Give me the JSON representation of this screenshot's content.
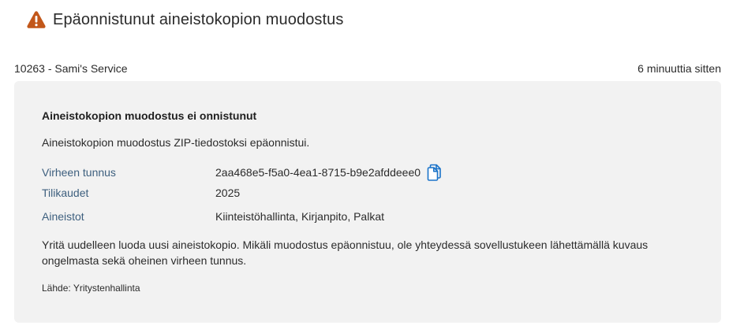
{
  "header": {
    "icon": "warning-icon",
    "icon_color": "#c2571a",
    "title": "Epäonnistunut aineistokopion muodostus"
  },
  "meta": {
    "source_label": "10263 - Sami's Service",
    "time_ago": "6 minuuttia sitten"
  },
  "card": {
    "title": "Aineistokopion muodostus ei onnistunut",
    "description": "Aineistokopion muodostus ZIP-tiedostoksi epäonnistui.",
    "details": [
      {
        "label": "Virheen tunnus",
        "value": "2aa468e5-f5a0-4ea1-8715-b9e2afddeee0",
        "action_icon": "copy-icon"
      },
      {
        "label": "Tilikaudet",
        "value": "2025"
      },
      {
        "label": "Aineistot",
        "value": "Kiinteistöhallinta, Kirjanpito, Palkat"
      }
    ],
    "note": "Yritä uudelleen luoda uusi aineistokopio. Mikäli muodostus epäonnistuu, ole yhteydessä sovellustukeen lähettämällä kuvaus ongelmasta sekä oheinen virheen tunnus.",
    "source": "Lähde: Yritystenhallinta"
  },
  "colors": {
    "accent": "#1a73c9",
    "label": "#3d5f7e",
    "card_bg": "#f2f2f2",
    "warning": "#c2571a"
  }
}
